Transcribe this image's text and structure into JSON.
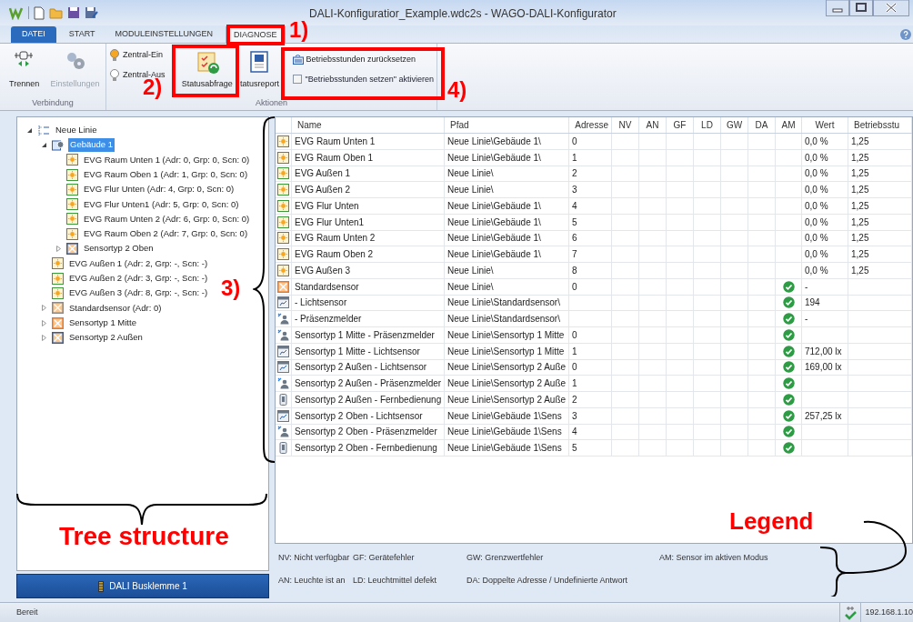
{
  "window": {
    "title": "DALI-Konfiguratior_Example.wdc2s - WAGO-DALI-Konfigurator"
  },
  "ribbon_tabs": [
    {
      "label": "DATEI",
      "kind": "file",
      "selected": false
    },
    {
      "label": "START",
      "kind": "tab",
      "selected": false
    },
    {
      "label": "MODULEINSTELLUNGEN",
      "kind": "tab",
      "selected": false
    },
    {
      "label": "DIAGNOSE",
      "kind": "tab",
      "selected": true
    }
  ],
  "ribbon_groups": [
    {
      "label": "Verbindung",
      "buttons": [
        {
          "label": "Trennen",
          "kind": "connector",
          "disabled": false
        },
        {
          "label": "Einstellungen",
          "kind": "gears",
          "disabled": true
        }
      ]
    },
    {
      "label": "Aktionen",
      "buttons": [
        {
          "label": "Zentral-Ein",
          "kind": "bulb-on",
          "disabled": false
        },
        {
          "label": "Zentral-Aus",
          "kind": "bulb-off",
          "disabled": false
        },
        {
          "label": "Statusabfrage",
          "kind": "status",
          "disabled": false
        },
        {
          "label": "tatusreport",
          "kind": "report",
          "disabled": false
        },
        {
          "label": "Betriebsstunden zurücksetzen",
          "kind": "reset",
          "disabled": false
        },
        {
          "label": "\"Betriebsstunden setzen\" aktivieren",
          "kind": "checkbox",
          "checked": false
        }
      ]
    }
  ],
  "tree": [
    {
      "label": "Neue Linie",
      "kind": "line",
      "expanded": true,
      "selected": false,
      "children": [
        {
          "label": "Gebäude 1",
          "kind": "building",
          "expanded": true,
          "selected": true,
          "children": [
            {
              "label": "EVG Raum Unten 1 (Adr: 0, Grp: 0, Scn: 0)",
              "kind": "ballast",
              "selected": false
            },
            {
              "label": "EVG Raum Oben 1 (Adr: 1, Grp: 0, Scn: 0)",
              "kind": "ballast",
              "selected": false
            },
            {
              "label": "EVG Flur Unten (Adr: 4, Grp: 0, Scn: 0)",
              "kind": "ballast",
              "selected": false
            },
            {
              "label": "EVG Flur Unten1 (Adr: 5, Grp: 0, Scn: 0)",
              "kind": "ballast",
              "selected": false
            },
            {
              "label": "EVG Raum Unten 2 (Adr: 6, Grp: 0, Scn: 0)",
              "kind": "ballast",
              "selected": false
            },
            {
              "label": "EVG Raum Oben 2 (Adr: 7, Grp: 0, Scn: 0)",
              "kind": "ballast",
              "selected": false
            },
            {
              "label": "Sensortyp 2 Oben",
              "kind": "sensor",
              "color": "#2f5fa8",
              "expanded": false,
              "selected": false
            }
          ]
        },
        {
          "label": "EVG Außen 1 (Adr: 2, Grp: -, Scn: -)",
          "kind": "ballast",
          "selected": false
        },
        {
          "label": "EVG Außen 2 (Adr: 3, Grp: -, Scn: -)",
          "kind": "ballast",
          "selected": false
        },
        {
          "label": "EVG Außen 3 (Adr: 8, Grp: -, Scn: -)",
          "kind": "ballast",
          "selected": false
        },
        {
          "label": "Standardsensor (Adr: 0)",
          "kind": "sensor",
          "color": "#8a8a8a",
          "expanded": false,
          "selected": false
        },
        {
          "label": "Sensortyp 1 Mitte",
          "kind": "sensor",
          "color": "#e8772e",
          "expanded": false,
          "selected": false
        },
        {
          "label": "Sensortyp 2 Außen",
          "kind": "sensor",
          "color": "#2f5fa8",
          "expanded": false,
          "selected": false
        }
      ]
    }
  ],
  "module_button": {
    "label": "DALI Busklemme 1"
  },
  "table": {
    "columns": [
      "Name",
      "Pfad",
      "Adresse",
      "NV",
      "AN",
      "GF",
      "LD",
      "GW",
      "DA",
      "AM",
      "Wert",
      "Betriebsstu"
    ],
    "rows": [
      {
        "kind": "ballast",
        "name": "EVG Raum Unten 1",
        "path": "Neue Linie\\Gebäude 1\\",
        "address": "0",
        "am": false,
        "value": "0,0 %",
        "hours": "1,25"
      },
      {
        "kind": "ballast",
        "name": "EVG Raum Oben 1",
        "path": "Neue Linie\\Gebäude 1\\",
        "address": "1",
        "am": false,
        "value": "0,0 %",
        "hours": "1,25"
      },
      {
        "kind": "ballast",
        "name": "EVG Außen 1",
        "path": "Neue Linie\\",
        "address": "2",
        "am": false,
        "value": "0,0 %",
        "hours": "1,25"
      },
      {
        "kind": "ballast",
        "name": "EVG Außen 2",
        "path": "Neue Linie\\",
        "address": "3",
        "am": false,
        "value": "0,0 %",
        "hours": "1,25"
      },
      {
        "kind": "ballast",
        "name": "EVG Flur Unten",
        "path": "Neue Linie\\Gebäude 1\\",
        "address": "4",
        "am": false,
        "value": "0,0 %",
        "hours": "1,25"
      },
      {
        "kind": "ballast",
        "name": "EVG Flur Unten1",
        "path": "Neue Linie\\Gebäude 1\\",
        "address": "5",
        "am": false,
        "value": "0,0 %",
        "hours": "1,25"
      },
      {
        "kind": "ballast",
        "name": "EVG Raum Unten 2",
        "path": "Neue Linie\\Gebäude 1\\",
        "address": "6",
        "am": false,
        "value": "0,0 %",
        "hours": "1,25"
      },
      {
        "kind": "ballast",
        "name": "EVG Raum Oben 2",
        "path": "Neue Linie\\Gebäude 1\\",
        "address": "7",
        "am": false,
        "value": "0,0 %",
        "hours": "1,25"
      },
      {
        "kind": "ballast",
        "name": "EVG Außen 3",
        "path": "Neue Linie\\",
        "address": "8",
        "am": false,
        "value": "0,0 %",
        "hours": "1,25"
      },
      {
        "kind": "sensor",
        "name": "Standardsensor",
        "path": "Neue Linie\\",
        "address": "0",
        "am": true,
        "value": "-"
      },
      {
        "kind": "light",
        "name": "- Lichtsensor",
        "path": "Neue Linie\\Standardsensor\\",
        "am": true,
        "value": "194"
      },
      {
        "kind": "presence",
        "name": "- Präsenzmelder",
        "path": "Neue Linie\\Standardsensor\\",
        "am": true,
        "value": "-"
      },
      {
        "kind": "presence",
        "name": "Sensortyp 1 Mitte - Präsenzmelder",
        "path": "Neue Linie\\Sensortyp 1 Mitte",
        "address": "0",
        "am": true
      },
      {
        "kind": "light",
        "name": "Sensortyp 1 Mitte - Lichtsensor",
        "path": "Neue Linie\\Sensortyp 1 Mitte",
        "address": "1",
        "am": true,
        "value": "712,00 lx"
      },
      {
        "kind": "light",
        "name": "Sensortyp 2 Außen - Lichtsensor",
        "path": "Neue Linie\\Sensortyp 2 Auße",
        "address": "0",
        "am": true,
        "value": "169,00 lx"
      },
      {
        "kind": "presence",
        "name": "Sensortyp 2 Außen - Präsenzmelder",
        "path": "Neue Linie\\Sensortyp 2 Auße",
        "address": "1",
        "am": true
      },
      {
        "kind": "remote",
        "name": "Sensortyp 2 Außen - Fernbedienung",
        "path": "Neue Linie\\Sensortyp 2 Auße",
        "address": "2",
        "am": true
      },
      {
        "kind": "light",
        "name": "Sensortyp 2 Oben - Lichtsensor",
        "path": "Neue Linie\\Gebäude 1\\Sens",
        "address": "3",
        "am": true,
        "value": "257,25 lx"
      },
      {
        "kind": "presence",
        "name": "Sensortyp 2 Oben - Präsenzmelder",
        "path": "Neue Linie\\Gebäude 1\\Sens",
        "address": "4",
        "am": true
      },
      {
        "kind": "remote",
        "name": "Sensortyp 2 Oben - Fernbedienung",
        "path": "Neue Linie\\Gebäude 1\\Sens",
        "address": "5",
        "am": true
      }
    ]
  },
  "legend": [
    "NV: Nicht verfügbar",
    "GF: Gerätefehler",
    "GW: Grenzwertfehler",
    "AM: Sensor im aktiven Modus",
    "AN: Leuchte ist an",
    "LD: Leuchtmittel defekt",
    "DA: Doppelte Adresse / Undefinierte Antwort"
  ],
  "status_bar": {
    "text": "Bereit",
    "address": "192.168.1.10"
  },
  "annotations": [
    "1)",
    "2)",
    "3)",
    "4)",
    "Tree structure",
    "Legend"
  ]
}
